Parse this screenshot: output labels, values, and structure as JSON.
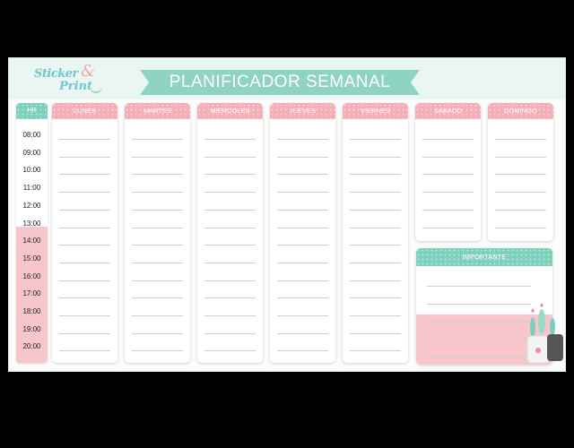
{
  "title": "PLANIFICADOR SEMANAL",
  "logo": {
    "line1": "Sticker",
    "amp": "&",
    "line2": "Print"
  },
  "hours_header": "HR",
  "hours": [
    "08:00",
    "09:00",
    "10:00",
    "11:00",
    "12:00",
    "13:00",
    "14:00",
    "15:00",
    "16:00",
    "17:00",
    "18:00",
    "19:00",
    "20:00"
  ],
  "days": [
    "LUNES",
    "MARTES",
    "MIERCOLES",
    "JUEVES",
    "VIERNES",
    "SABADO",
    "DOMINGO"
  ],
  "importante": "IMPORTANTE",
  "colors": {
    "mint": "#7fcfbd",
    "pink": "#f4aeb5",
    "light_pink": "#f7c6cb",
    "banner": "#8fd3c2"
  }
}
